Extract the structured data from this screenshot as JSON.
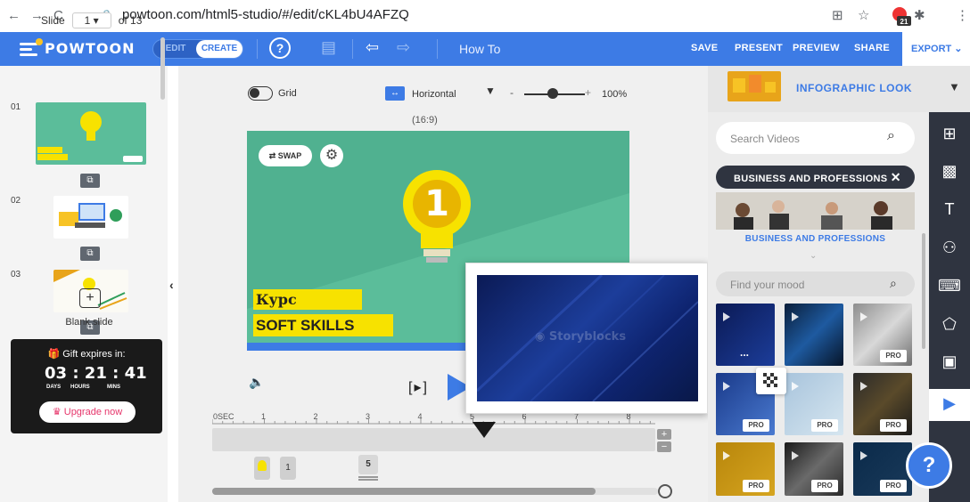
{
  "browser": {
    "url": "powtoon.com/html5-studio/#/edit/cKL4bU4AFZQ",
    "ext_badge": "21"
  },
  "header": {
    "logo": "POWTOON",
    "mode_edit": "EDIT",
    "mode_create": "CREATE",
    "help": "?",
    "title": "How To",
    "save": "SAVE",
    "present": "PRESENT",
    "preview": "PREVIEW",
    "share": "SHARE",
    "export": "EXPORT"
  },
  "left": {
    "slide_label": "Slide",
    "slide_value": "1",
    "slide_total": "of 13",
    "slides": [
      {
        "num": "01"
      },
      {
        "num": "02"
      },
      {
        "num": "03"
      }
    ],
    "blank_label": "Blank slide",
    "gift_title": "Gift expires in:",
    "timer_days": "03",
    "timer_hours": "21",
    "timer_mins": "41",
    "lbl_days": "DAYS",
    "lbl_hours": "HOURS",
    "lbl_mins": "MINS",
    "upgrade": "Upgrade now"
  },
  "canvas": {
    "grid_label": "Grid",
    "orientation": "Horizontal",
    "zoom": "100%",
    "aspect": "(16:9)",
    "swap": "SWAP",
    "line1": "Курс",
    "line2": "SOFT SKILLS",
    "digit": "1"
  },
  "timeline": {
    "start": "0SEC",
    "ticks": [
      "1",
      "2",
      "3",
      "4",
      "5",
      "6",
      "7",
      "8"
    ],
    "chip1": "1",
    "chip2": "5"
  },
  "popup": {
    "watermark": "Storyblocks"
  },
  "right": {
    "look_title": "INFOGRAPHIC LOOK",
    "search_placeholder": "Search Videos",
    "category": "BUSINESS AND PROFESSIONS",
    "category_label": "BUSINESS AND PROFESSIONS",
    "mood_placeholder": "Find your mood",
    "pro": "PRO",
    "thumb_dots": "..."
  },
  "help_bubble": "?",
  "colors": {
    "brand_blue": "#3d7be5",
    "canvas_green": "#5bbd9a",
    "highlight_yellow": "#f7e200",
    "toolbar_dark": "#2f3440"
  }
}
